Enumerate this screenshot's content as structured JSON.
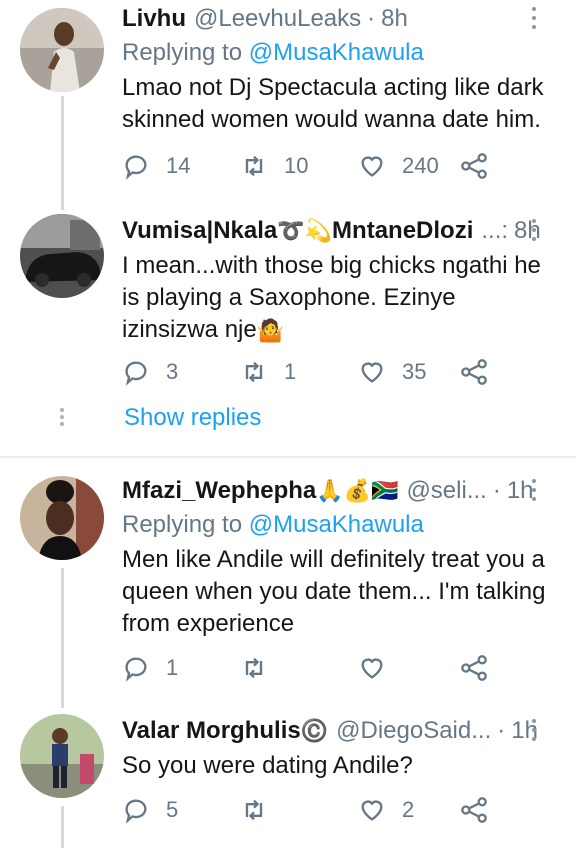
{
  "tweets": [
    {
      "name": "Livhu",
      "handle": "@LeevhuLeaks",
      "sep": "·",
      "time": "8h",
      "replying_prefix": "Replying to ",
      "replying_to": "@MusaKhawula",
      "text": "Lmao not Dj Spectacula acting like dark skinned women would wanna date him.",
      "replies": "14",
      "retweets": "10",
      "likes": "240"
    },
    {
      "name": "Vumisa|Nkala",
      "name_emoji": "➰💫",
      "name_tail": "MntaneDlozi",
      "handle_trunc": "...:",
      "time": "8h",
      "text": "I mean...with those big chicks ngathi he is playing a Saxophone. Ezinye izinsizwa nje",
      "text_emoji": "🤷",
      "replies": "3",
      "retweets": "1",
      "likes": "35"
    },
    {
      "name": "Mfazi_Wephepha",
      "name_emoji": "🙏💰🇿🇦",
      "handle": "@seli...",
      "sep": "·",
      "time": "1h",
      "replying_prefix": "Replying to ",
      "replying_to": "@MusaKhawula",
      "text": "Men like Andile will definitely treat you a queen when you date them... I'm talking from experience",
      "replies": "1",
      "retweets": "",
      "likes": ""
    },
    {
      "name": "Valar Morghulis",
      "name_emoji": "©️",
      "handle": "@DiegoSaid...",
      "sep": "·",
      "time": "1h",
      "text": "So you were dating Andile?",
      "replies": "5",
      "retweets": "",
      "likes": "2"
    }
  ],
  "show_replies": "Show replies",
  "colors": {
    "accent": "#1da1f2",
    "muted": "#657786",
    "divider": "#e6ecf0",
    "thread": "#cfd9de"
  },
  "icons": [
    "reply-icon",
    "retweet-icon",
    "like-icon",
    "share-icon",
    "more-icon"
  ]
}
